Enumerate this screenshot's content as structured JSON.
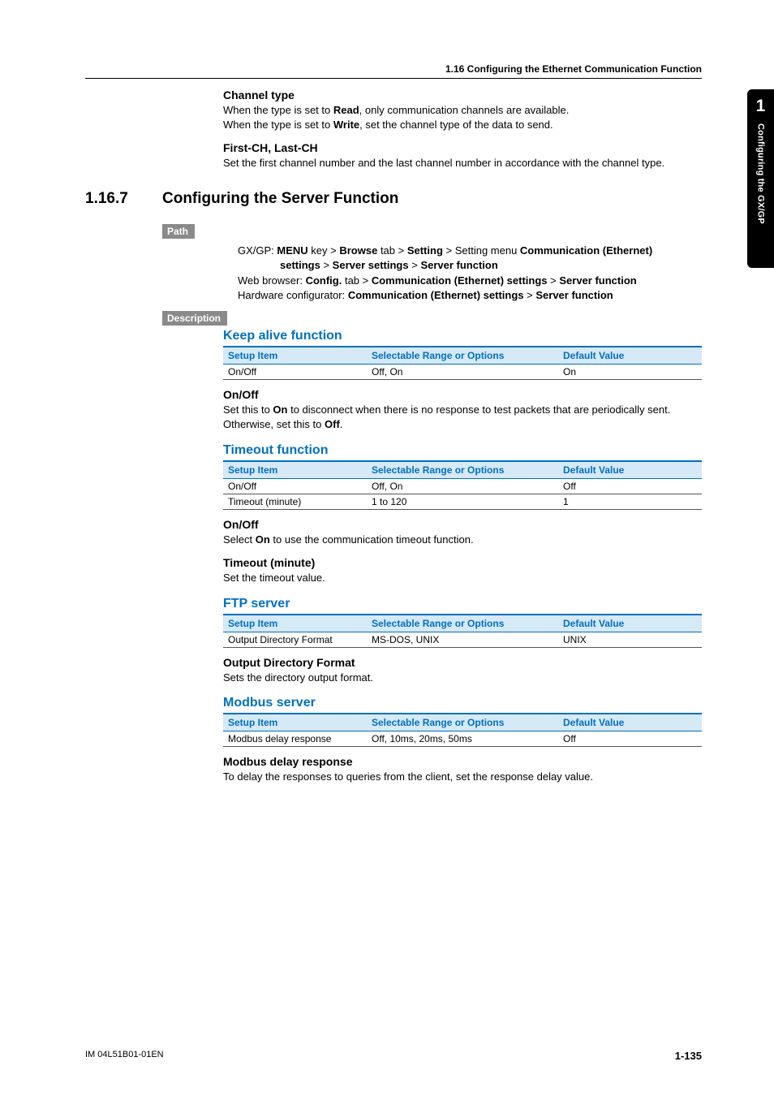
{
  "side_tab": {
    "number": "1",
    "title": "Configuring the GX/GP"
  },
  "running_header": "1.16  Configuring the Ethernet Communication Function",
  "preamble": {
    "channel_type": {
      "heading": "Channel type",
      "line1_pre": "When the type is set to ",
      "line1_bold": "Read",
      "line1_post": ", only communication channels are available.",
      "line2_pre": "When the type is set to ",
      "line2_bold": "Write",
      "line2_post": ", set the channel type of the data to send."
    },
    "first_last": {
      "heading": "First-CH, Last-CH",
      "text": "Set the first channel number and the last channel number in accordance with the channel type."
    }
  },
  "h2": {
    "num": "1.16.7",
    "title": "Configuring the Server Function"
  },
  "path": {
    "label": "Path",
    "l1a": "GX/GP: ",
    "l1b": "MENU",
    "l1c": " key > ",
    "l1d": "Browse",
    "l1e": " tab > ",
    "l1f": "Setting",
    "l1g": " > Setting menu ",
    "l1h": "Communication (Ethernet) ",
    "l1i": "settings",
    "l1j": " > ",
    "l1k": "Server settings",
    "l1l": " > ",
    "l1m": "Server function",
    "l2a": "Web browser: ",
    "l2b": "Config.",
    "l2c": " tab > ",
    "l2d": "Communication (Ethernet) settings",
    "l2e": " > ",
    "l2f": "Server function",
    "l3a": "Hardware configurator: ",
    "l3b": "Communication (Ethernet) settings",
    "l3c": " > ",
    "l3d": "Server function"
  },
  "description_label": "Description",
  "table_headers": {
    "c1": "Setup Item",
    "c2": "Selectable Range or Options",
    "c3": "Default Value"
  },
  "keep_alive": {
    "title": "Keep alive function",
    "row": {
      "c1": "On/Off",
      "c2": "Off, On",
      "c3": "On"
    },
    "onoff_h": "On/Off",
    "onoff_t1": "Set this to ",
    "onoff_b1": "On",
    "onoff_t2": " to disconnect when there is no response to test packets that are periodically sent. Otherwise, set this to ",
    "onoff_b2": "Off",
    "onoff_t3": "."
  },
  "timeout": {
    "title": "Timeout function",
    "rows": [
      {
        "c1": "On/Off",
        "c2": "Off, On",
        "c3": "Off"
      },
      {
        "c1": "Timeout (minute)",
        "c2": "1 to 120",
        "c3": "1"
      }
    ],
    "onoff_h": "On/Off",
    "onoff_t1": "Select ",
    "onoff_b1": "On",
    "onoff_t2": " to use the communication timeout function.",
    "timeout_h": "Timeout (minute)",
    "timeout_t": "Set the timeout value."
  },
  "ftp": {
    "title": "FTP server",
    "row": {
      "c1": "Output Directory Format",
      "c2": "MS-DOS, UNIX",
      "c3": "UNIX"
    },
    "odf_h": "Output Directory Format",
    "odf_t": "Sets the directory output format."
  },
  "modbus": {
    "title": "Modbus server",
    "row": {
      "c1": "Modbus delay response",
      "c2": "Off, 10ms, 20ms, 50ms",
      "c3": "Off"
    },
    "mdr_h": "Modbus delay response",
    "mdr_t": "To delay the responses to queries from the client, set the response delay value."
  },
  "footer": {
    "left": "IM 04L51B01-01EN",
    "right": "1-135"
  }
}
